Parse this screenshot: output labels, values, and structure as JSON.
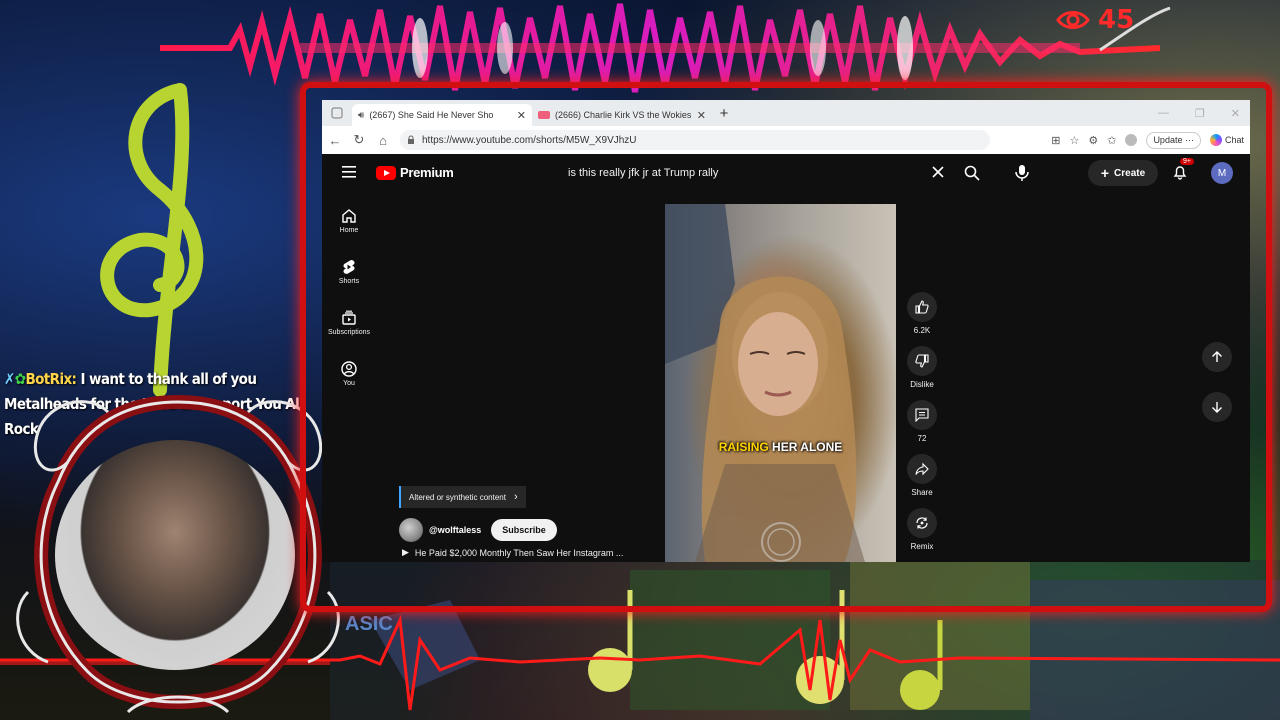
{
  "overlay": {
    "viewer_count": "45",
    "chat": {
      "username": "BotRix:",
      "message": "I want to thank all of you Metalheads for the Love & Support You All Rock"
    }
  },
  "browser": {
    "tabs": [
      {
        "title": "(2667) She Said He Never Sho",
        "active": true
      },
      {
        "title": "(2666) Charlie Kirk VS the Wokies",
        "active": false
      }
    ],
    "url": "https://www.youtube.com/shorts/M5W_X9VJhzU",
    "update_label": "Update",
    "copilot_label": "Chat"
  },
  "youtube": {
    "brand": "Premium",
    "search_query": "is this really jfk jr at Trump rally",
    "create_label": "Create",
    "notif_badge": "9+",
    "avatar_letter": "M",
    "sidebar": {
      "items": [
        {
          "label": "Home",
          "icon": "home-icon"
        },
        {
          "label": "Shorts",
          "icon": "shorts-icon"
        },
        {
          "label": "Subscriptions",
          "icon": "subscriptions-icon"
        },
        {
          "label": "You",
          "icon": "you-icon"
        }
      ]
    },
    "short": {
      "caption_highlight": "RAISING",
      "caption_rest": " HER ALONE",
      "altered_label": "Altered or synthetic content",
      "channel": "@wolftaless",
      "subscribe_label": "Subscribe",
      "title": "He Paid $2,000 Monthly Then Saw Her Instagram ..."
    },
    "actions": {
      "like_count": "6.2K",
      "dislike_label": "Dislike",
      "comment_count": "72",
      "share_label": "Share",
      "remix_label": "Remix"
    }
  },
  "colors": {
    "browser_border": "#d01010",
    "yt_red": "#ff0000",
    "yt_bg": "#0f0f0f",
    "caption_highlight": "#ffd400",
    "viewer_count": "#ff2a2a"
  }
}
